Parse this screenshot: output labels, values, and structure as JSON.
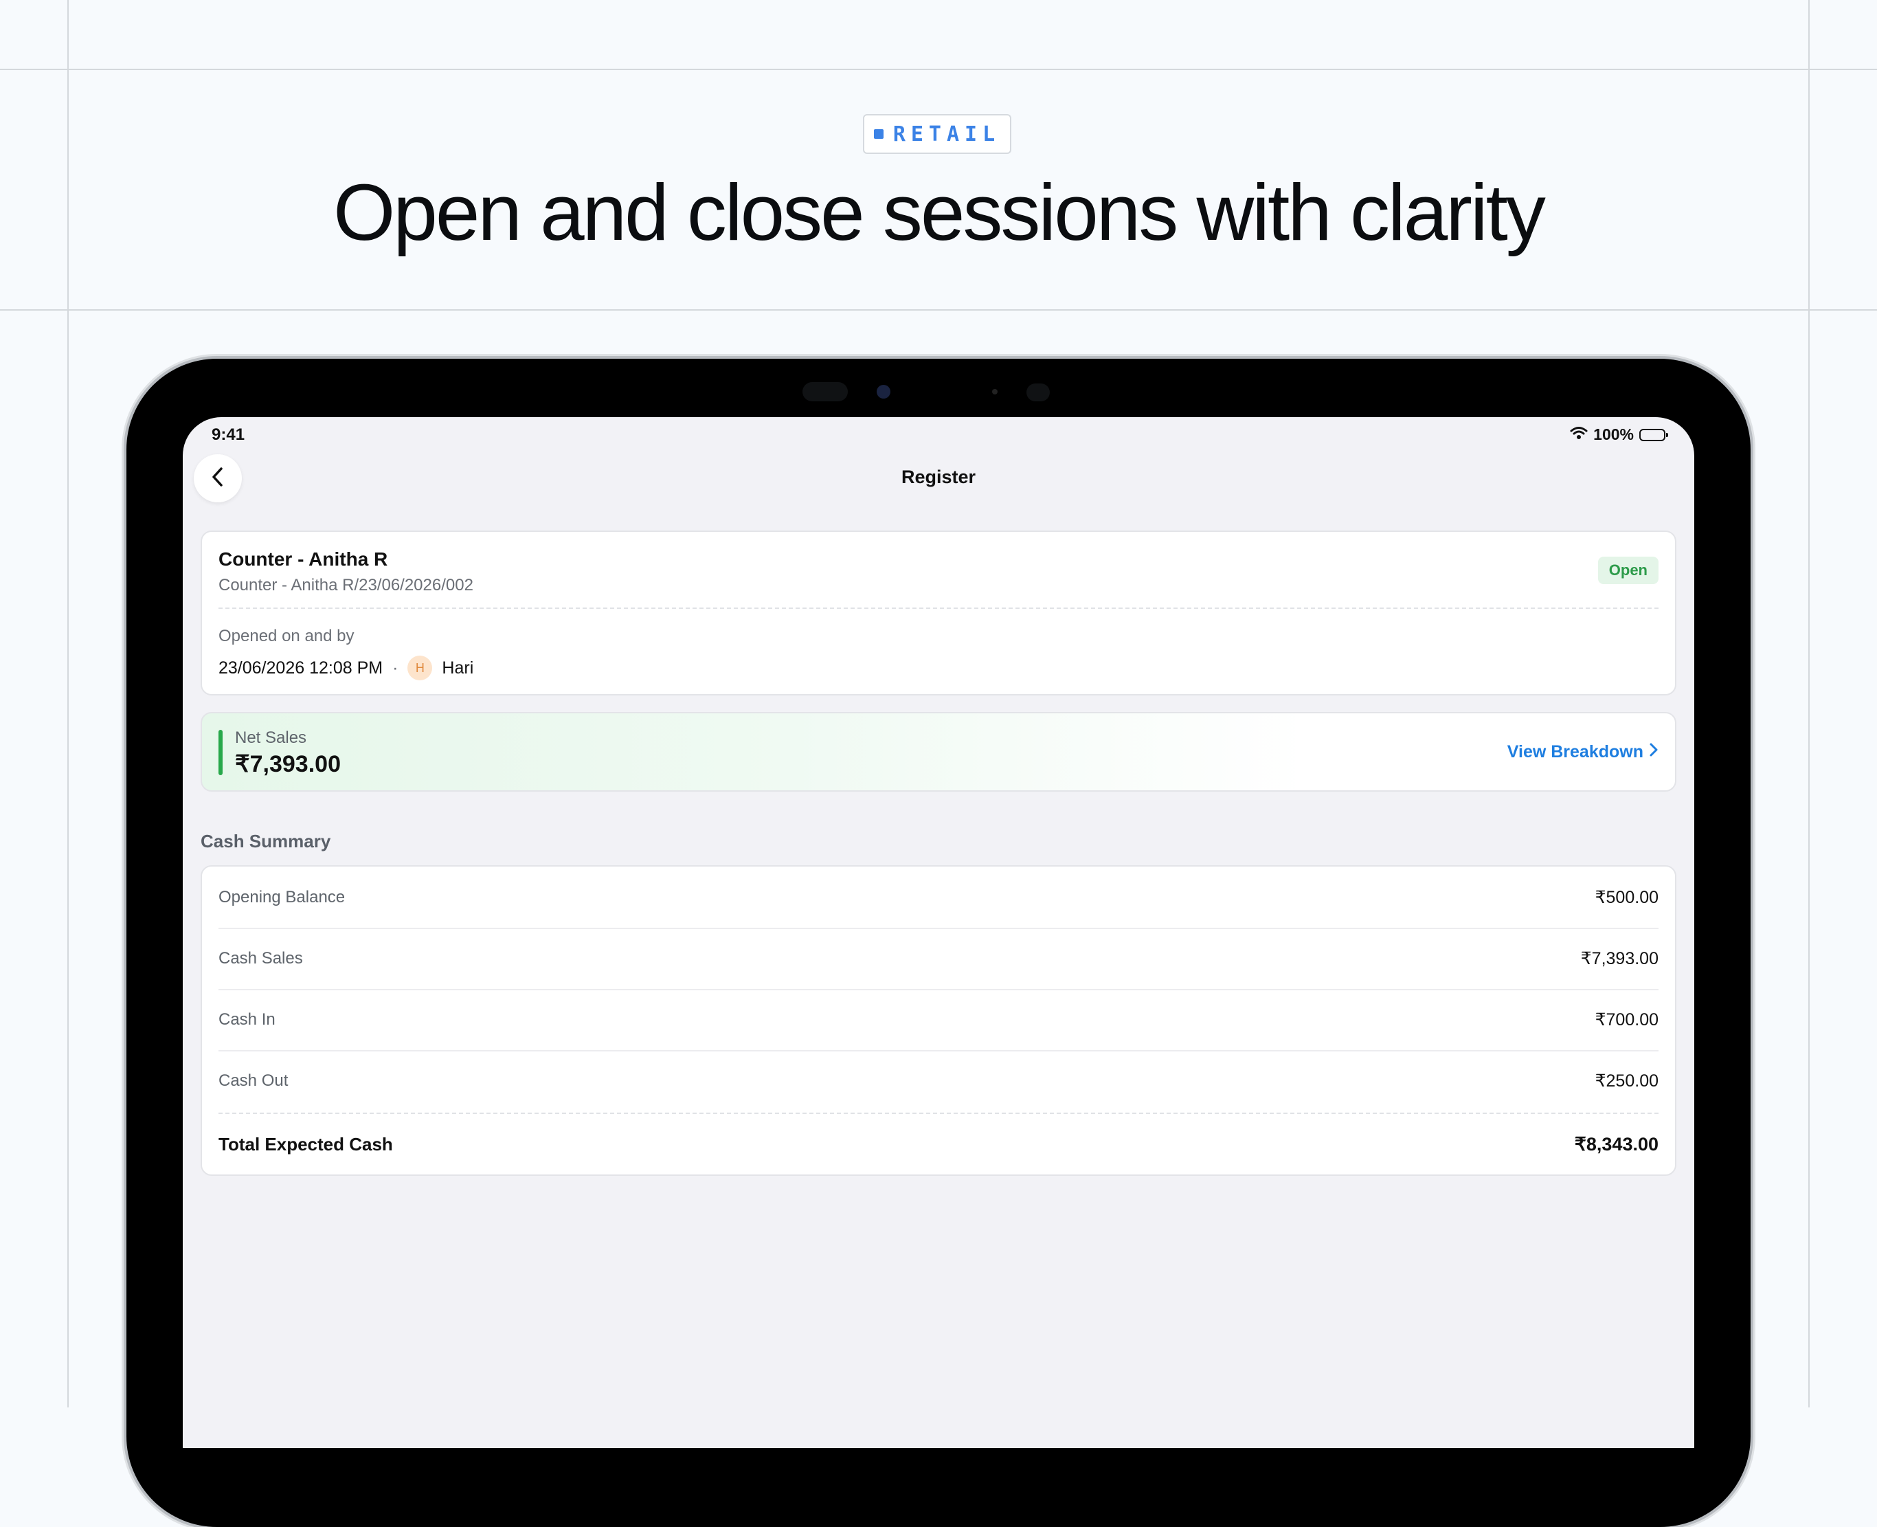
{
  "banner": {
    "tag": "RETAIL",
    "headline": "Open and close sessions with clarity"
  },
  "status_bar": {
    "time": "9:41",
    "battery": "100%"
  },
  "nav": {
    "title": "Register"
  },
  "session": {
    "name": "Counter - Anitha R",
    "reference": "Counter - Anitha R/23/06/2026/002",
    "status": "Open",
    "opened_label": "Opened on and by",
    "opened_at": "23/06/2026 12:08 PM",
    "separator": "·",
    "user_initial": "H",
    "user_name": "Hari"
  },
  "net_sales": {
    "label": "Net Sales",
    "value": "₹7,393.00",
    "link": "View Breakdown"
  },
  "cash_summary": {
    "title": "Cash Summary",
    "rows": [
      {
        "label": "Opening Balance",
        "value": "₹500.00"
      },
      {
        "label": "Cash Sales",
        "value": "₹7,393.00"
      },
      {
        "label": "Cash In",
        "value": "₹700.00"
      },
      {
        "label": "Cash Out",
        "value": "₹250.00"
      }
    ],
    "total": {
      "label": "Total Expected Cash",
      "value": "₹8,343.00"
    }
  },
  "colors": {
    "accent": "#1e7ee0",
    "tag": "#3b82e6",
    "success": "#27a84a",
    "badge_bg": "#e4f5e8"
  },
  "icons": [
    "chevron-left-icon",
    "wifi-icon",
    "battery-icon",
    "chevron-right-icon"
  ]
}
